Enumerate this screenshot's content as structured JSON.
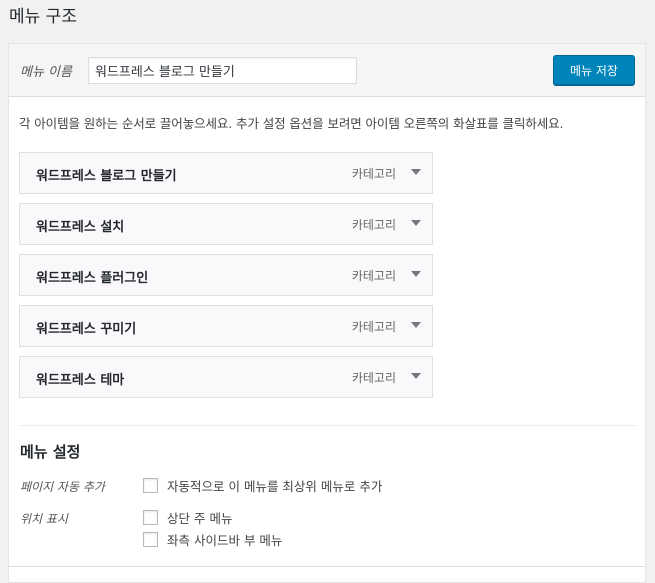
{
  "page": {
    "title": "메뉴 구조"
  },
  "header": {
    "menu_name_label": "메뉴 이름",
    "menu_name_value": "워드프레스 블로그 만들기",
    "save_label": "메뉴 저장"
  },
  "instructions": "각 아이템을 원하는 순서로 끌어놓으세요. 추가 설정 옵션을 보려면 아이템 오른쪽의 화살표를 클릭하세요.",
  "menu_items": [
    {
      "title": "워드프레스 블로그 만들기",
      "type": "카테고리"
    },
    {
      "title": "워드프레스 설치",
      "type": "카테고리"
    },
    {
      "title": "워드프레스 플러그인",
      "type": "카테고리"
    },
    {
      "title": "워드프레스 꾸미기",
      "type": "카테고리"
    },
    {
      "title": "워드프레스 테마",
      "type": "카테고리"
    }
  ],
  "settings": {
    "title": "메뉴 설정",
    "auto_add_label": "페이지 자동 추가",
    "auto_add_option": "자동적으로 이 메뉴를 최상위 메뉴로 추가",
    "location_label": "위치 표시",
    "locations": [
      "상단 주 메뉴",
      "좌측 사이드바 부 메뉴"
    ]
  },
  "colors": {
    "primary_button": "#0085ba",
    "page_background": "#f1f1f1",
    "item_background": "#fbf8fb"
  }
}
